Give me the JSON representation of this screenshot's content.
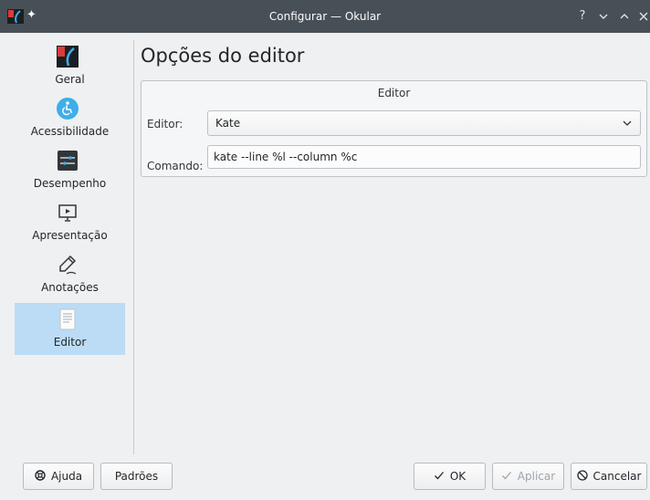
{
  "window": {
    "title": "Configurar — Okular",
    "controls": {
      "help": "?",
      "minimize": "⌄",
      "maximize": "⌃",
      "close": "✕"
    }
  },
  "sidebar": {
    "items": [
      {
        "label": "Geral",
        "icon": "okular-icon"
      },
      {
        "label": "Acessibilidade",
        "icon": "accessibility-icon"
      },
      {
        "label": "Desempenho",
        "icon": "performance-icon"
      },
      {
        "label": "Apresentação",
        "icon": "presentation-icon"
      },
      {
        "label": "Anotações",
        "icon": "annotation-pen-icon"
      },
      {
        "label": "Editor",
        "icon": "document-icon",
        "selected": true
      }
    ]
  },
  "page": {
    "title": "Opções do editor",
    "group": {
      "title": "Editor",
      "editor_label": "Editor:",
      "editor_value": "Kate",
      "command_label": "Comando:",
      "command_value": "kate --line %l --column %c"
    }
  },
  "buttons": {
    "help": "Ajuda",
    "defaults": "Padrões",
    "ok": "OK",
    "apply": "Aplicar",
    "cancel": "Cancelar"
  },
  "colors": {
    "titlebar": "#475057",
    "selection": "#bcdcf5",
    "accent": "#3daee9"
  }
}
